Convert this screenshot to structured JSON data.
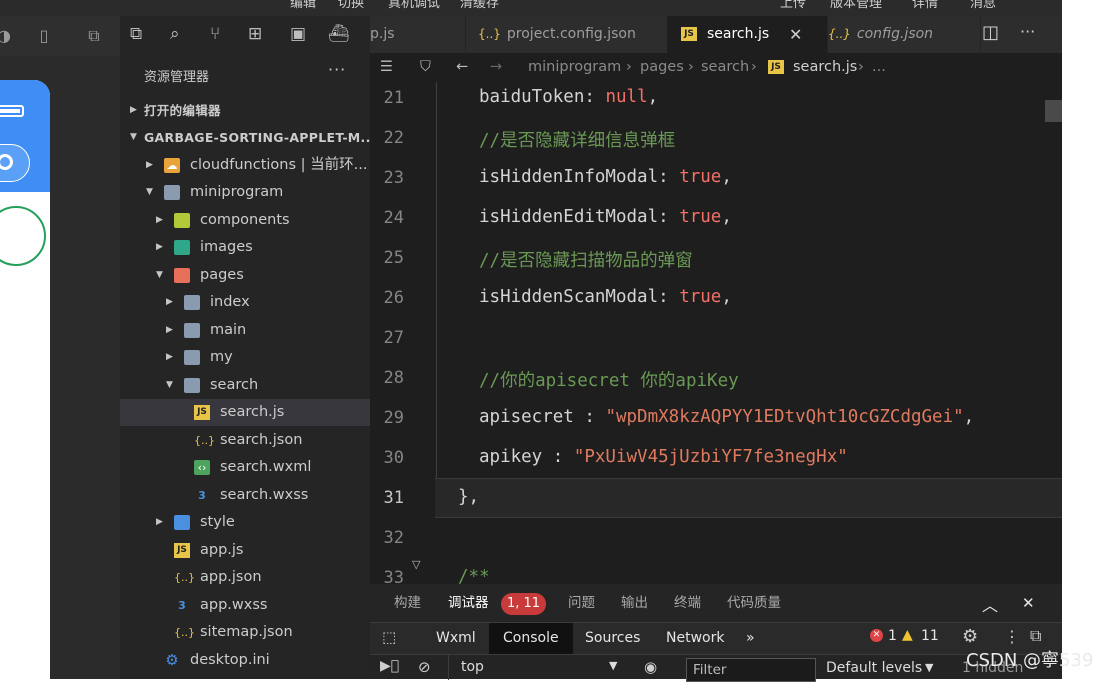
{
  "menubar": {
    "items": [
      "编辑",
      "切换",
      "真机调试",
      "清缓存",
      "上传",
      "版本管理",
      "详情",
      "消息"
    ]
  },
  "explorer": {
    "title": "资源管理器",
    "more": "···",
    "sections": {
      "open_editors": "打开的编辑器",
      "project": "GARBAGE-SORTING-APPLET-M..."
    },
    "tree": [
      {
        "label": "cloudfunctions | 当前环...",
        "icon": "cloud-folder-icon"
      },
      {
        "label": "miniprogram",
        "icon": "folder-open-icon"
      },
      {
        "label": "components",
        "icon": "components-folder-icon"
      },
      {
        "label": "images",
        "icon": "images-folder-icon"
      },
      {
        "label": "pages",
        "icon": "pages-folder-icon"
      },
      {
        "label": "index",
        "icon": "folder-icon"
      },
      {
        "label": "main",
        "icon": "folder-icon"
      },
      {
        "label": "my",
        "icon": "folder-icon"
      },
      {
        "label": "search",
        "icon": "folder-open-icon"
      },
      {
        "label": "search.js",
        "icon": "js-file-icon"
      },
      {
        "label": "search.json",
        "icon": "json-file-icon"
      },
      {
        "label": "search.wxml",
        "icon": "wxml-file-icon"
      },
      {
        "label": "search.wxss",
        "icon": "wxss-file-icon"
      },
      {
        "label": "style",
        "icon": "style-folder-icon"
      },
      {
        "label": "app.js",
        "icon": "js-file-icon"
      },
      {
        "label": "app.json",
        "icon": "json-file-icon"
      },
      {
        "label": "app.wxss",
        "icon": "wxss-file-icon"
      },
      {
        "label": "sitemap.json",
        "icon": "json-file-icon"
      },
      {
        "label": "desktop.ini",
        "icon": "gear-file-icon"
      }
    ]
  },
  "tabs": [
    {
      "label": "p.js"
    },
    {
      "label": "project.config.json"
    },
    {
      "label": "search.js"
    },
    {
      "label": "config.json"
    }
  ],
  "breadcrumb": {
    "parts": [
      "miniprogram",
      "pages",
      "search",
      "search.js",
      "..."
    ]
  },
  "code": {
    "line_numbers": [
      "21",
      "22",
      "23",
      "24",
      "25",
      "26",
      "27",
      "28",
      "29",
      "30",
      "31",
      "32",
      "33"
    ],
    "l21": {
      "key": "baiduToken",
      "val": "null"
    },
    "l22": {
      "comment": "//是否隐藏详细信息弹框"
    },
    "l23": {
      "key": "isHiddenInfoModal",
      "val": "true"
    },
    "l24": {
      "key": "isHiddenEditModal",
      "val": "true"
    },
    "l25": {
      "comment": "//是否隐藏扫描物品的弹窗"
    },
    "l26": {
      "key": "isHiddenScanModal",
      "val": "true"
    },
    "l28": {
      "comment": "//你的apisecret 你的apiKey"
    },
    "l29": {
      "key": "apisecret",
      "val": "\"wpDmX8kzAQPYY1EDtvQht10cGZCdgGei\""
    },
    "l30": {
      "key": "apikey",
      "val": "\"PxUiwV45jUzbiYF7fe3negHx\""
    },
    "l31": {
      "text": "},"
    },
    "l33": {
      "text": "/**"
    }
  },
  "panel": {
    "tabs": [
      "构建",
      "调试器",
      "问题",
      "输出",
      "终端",
      "代码质量"
    ],
    "debugger_badge": "1, 11"
  },
  "devtools": {
    "tabs": [
      "Wxml",
      "Console",
      "Sources",
      "Network"
    ],
    "more": "»",
    "errors": "1",
    "warnings": "11"
  },
  "console": {
    "context": "top",
    "filter_placeholder": "Filter",
    "levels": "Default levels",
    "hidden": "1 hidden"
  },
  "watermark": "CSDN @寧539",
  "colors": {
    "accent": "#3f8ef6",
    "error": "#c93b3b",
    "comment": "#6a9955",
    "string": "#e07a5f",
    "keyword": "#f47067"
  }
}
